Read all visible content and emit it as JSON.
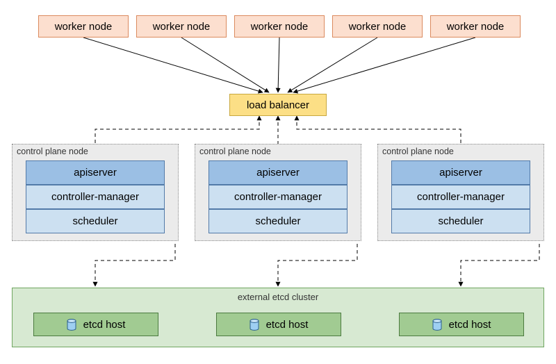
{
  "workers": {
    "label": "worker node",
    "count": 5
  },
  "load_balancer": {
    "label": "load balancer"
  },
  "control_plane": {
    "node_label": "control plane node",
    "count": 3,
    "components": {
      "apiserver": "apiserver",
      "controller_manager": "controller-manager",
      "scheduler": "scheduler"
    }
  },
  "etcd": {
    "cluster_label": "external etcd cluster",
    "host_label": "etcd host",
    "icon": "database-icon",
    "count": 3
  },
  "connections": {
    "workers_to_lb": "solid-arrow",
    "lb_to_apiservers": "dashed-bidirectional",
    "apiservers_to_etcd": "dashed-bidirectional"
  }
}
